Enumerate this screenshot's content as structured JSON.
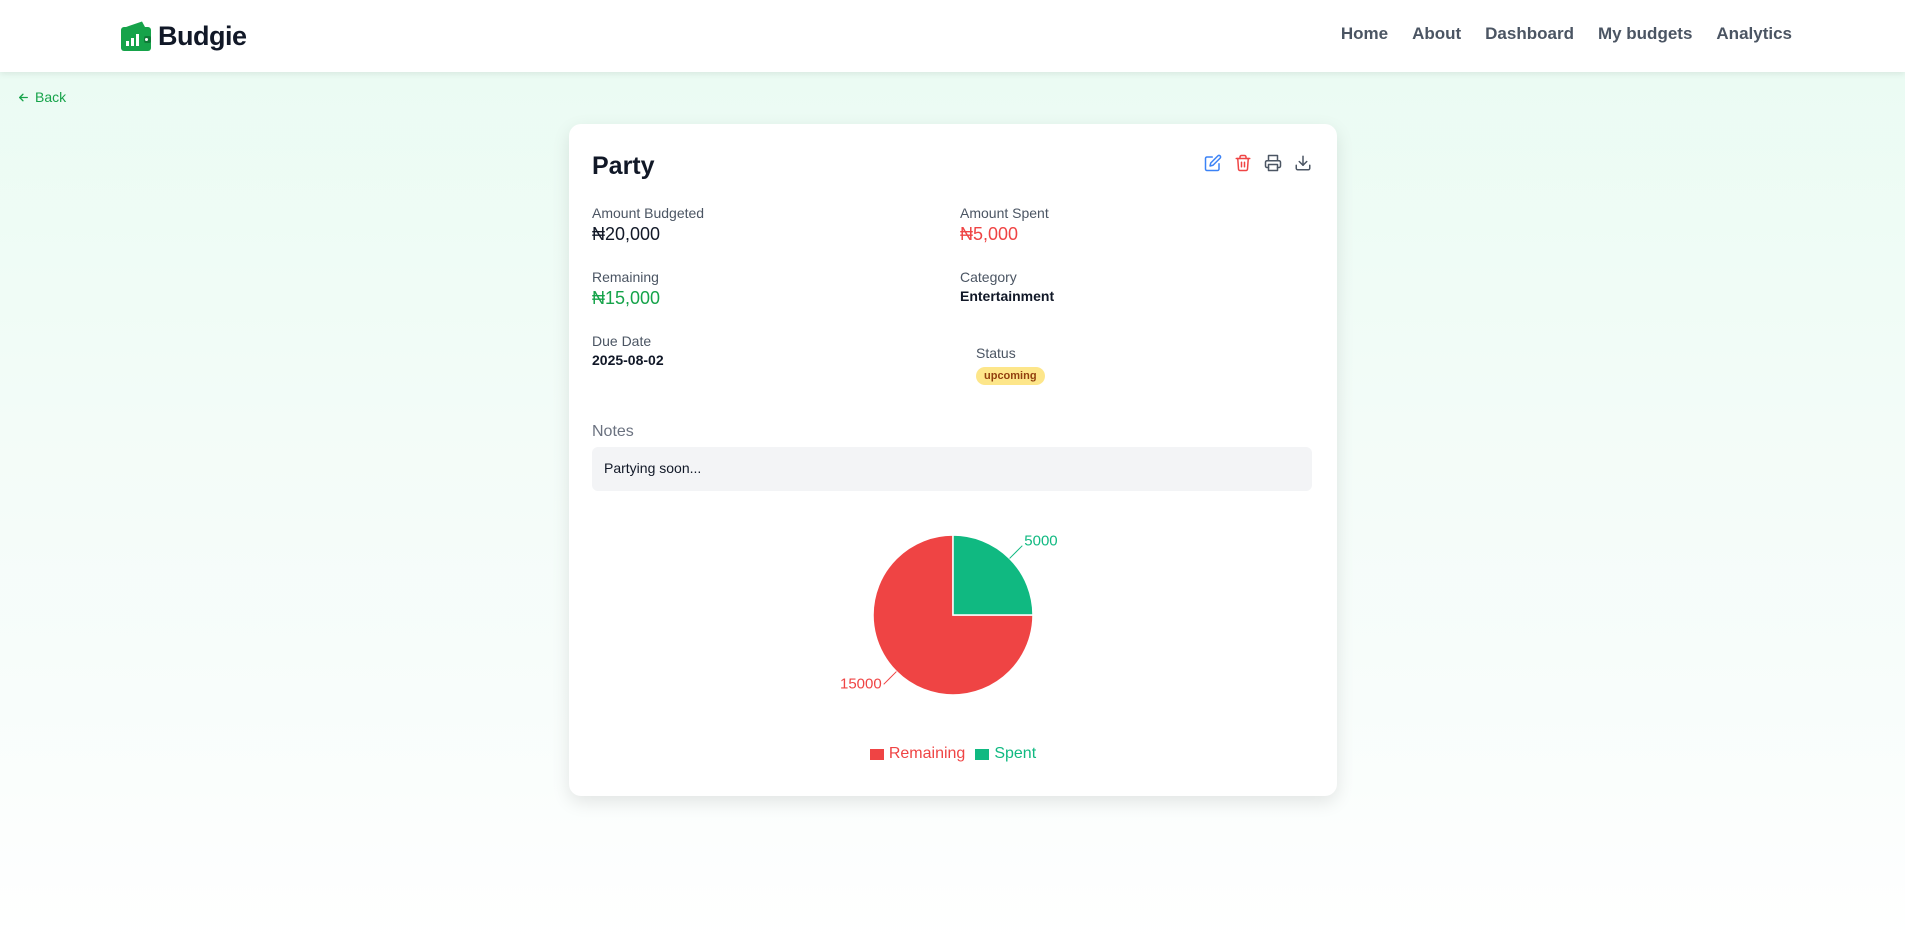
{
  "nav": {
    "brand": "Budgie",
    "links": [
      "Home",
      "About",
      "Dashboard",
      "My budgets",
      "Analytics"
    ]
  },
  "back_label": "Back",
  "budget": {
    "title": "Party",
    "amount_budgeted_label": "Amount Budgeted",
    "amount_budgeted": "₦20,000",
    "amount_spent_label": "Amount Spent",
    "amount_spent": "₦5,000",
    "remaining_label": "Remaining",
    "remaining": "₦15,000",
    "category_label": "Category",
    "category": "Entertainment",
    "due_date_label": "Due Date",
    "due_date": "2025-08-02",
    "status_label": "Status",
    "status": "upcoming",
    "notes_label": "Notes",
    "notes": "Partying soon..."
  },
  "icons": {
    "actions": [
      "edit-icon",
      "delete-icon",
      "print-icon",
      "download-icon"
    ],
    "back": "arrow-left-icon",
    "brand": "wallet-chart-logo"
  },
  "colors": {
    "brand_green": "#16a34a",
    "remaining": "#ef4444",
    "spent": "#10b981",
    "edit": "#3b82f6",
    "delete": "#ef4444",
    "status_bg": "#fde68a",
    "status_text": "#92400e"
  },
  "chart_data": {
    "type": "pie",
    "categories": [
      "Remaining",
      "Spent"
    ],
    "values": [
      15000,
      5000
    ],
    "colors": [
      "#ef4444",
      "#10b981"
    ],
    "data_labels": [
      "15000",
      "5000"
    ],
    "legend": [
      "Remaining",
      "Spent"
    ],
    "legend_position": "bottom"
  }
}
